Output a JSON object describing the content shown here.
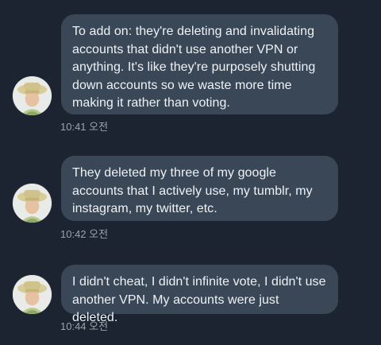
{
  "messages": [
    {
      "text": "To add on: they're deleting and invalidating accounts that didn't use another VPN or anything. It's like they're purposely shutting down accounts so we waste more time making it rather than voting.",
      "time": "10:41 오전"
    },
    {
      "text": "They deleted my three of my google accounts that I actively use, my tumblr, my instagram, my twitter, etc.",
      "time": "10:42 오전"
    },
    {
      "text": "I didn't cheat, I didn't infinite vote, I didn't use another VPN. My accounts were just deleted.",
      "time": "10:44 오전"
    }
  ],
  "colors": {
    "background": "#1b2430",
    "bubble": "#3a4757",
    "bubble_text": "#eef2f6",
    "timestamp": "#9aa3ad"
  }
}
